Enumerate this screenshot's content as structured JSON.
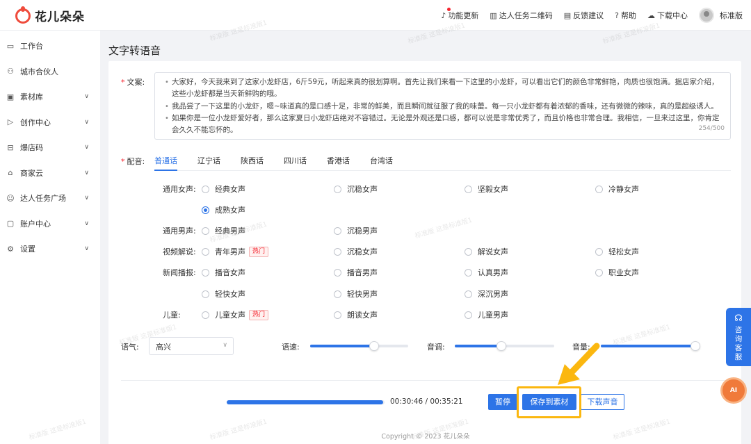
{
  "brand": {
    "name": "花儿朵朵"
  },
  "header": {
    "links": [
      {
        "label": "功能更新",
        "icon": "bell-icon"
      },
      {
        "label": "达人任务二维码",
        "icon": "qrcode-icon"
      },
      {
        "label": "反馈建议",
        "icon": "feedback-icon"
      },
      {
        "label": "帮助",
        "icon": "help-icon"
      },
      {
        "label": "下载中心",
        "icon": "cloud-download-icon"
      }
    ],
    "version": "标准版"
  },
  "sidebar": {
    "items": [
      {
        "label": "工作台",
        "icon": "monitor-icon",
        "expandable": false
      },
      {
        "label": "城市合伙人",
        "icon": "partner-icon",
        "expandable": false
      },
      {
        "label": "素材库",
        "icon": "image-icon",
        "expandable": true
      },
      {
        "label": "创作中心",
        "icon": "video-icon",
        "expandable": true
      },
      {
        "label": "爆店码",
        "icon": "code-icon",
        "expandable": true
      },
      {
        "label": "商家云",
        "icon": "store-icon",
        "expandable": true
      },
      {
        "label": "达人任务广场",
        "icon": "user-icon",
        "expandable": true
      },
      {
        "label": "账户中心",
        "icon": "account-icon",
        "expandable": true
      },
      {
        "label": "设置",
        "icon": "gear-icon",
        "expandable": true
      }
    ]
  },
  "page": {
    "title": "文字转语音"
  },
  "form": {
    "text_label": "文案:",
    "text_paragraphs": [
      "大家好，今天我来到了这家小龙虾店，6斤59元，听起来真的很划算啊。首先让我们来看一下这里的小龙虾，可以看出它们的颜色非常鲜艳，肉质也很饱满。据店家介绍，这些小龙虾都是当天新鲜购的哦。",
      "我品尝了一下这里的小龙虾，嗯~味道真的是口感十足，非常的鲜美，而且瞬间就征服了我的味蕾。每一只小龙虾都有着浓郁的香味，还有微微的辣味，真的是超级诱人。",
      "如果你是一位小龙虾爱好者，那么这家夏日小龙虾店绝对不容错过。无论是外观还是口感，都可以说是非常优秀了，而且价格也非常合理。我相信，一旦来过这里，你肯定会久久不能忘怀的。"
    ],
    "char_count": "254/500",
    "voice_label": "配音:",
    "tabs": [
      "普通话",
      "辽宁话",
      "陕西话",
      "四川话",
      "香港话",
      "台湾话"
    ],
    "active_tab": 0,
    "voice_groups": [
      {
        "label": "通用女声:",
        "options": [
          {
            "label": "经典女声"
          },
          {
            "label": "沉稳女声"
          },
          {
            "label": "坚毅女声"
          },
          {
            "label": "冷静女声"
          },
          {
            "label": "成熟女声",
            "selected": true
          }
        ]
      },
      {
        "label": "通用男声:",
        "options": [
          {
            "label": "经典男声"
          },
          {
            "label": "沉稳男声"
          }
        ]
      },
      {
        "label": "视频解说:",
        "options": [
          {
            "label": "青年男声",
            "tag": "热门"
          },
          {
            "label": "沉稳女声"
          },
          {
            "label": "解说女声"
          },
          {
            "label": "轻松女声"
          }
        ]
      },
      {
        "label": "新闻播报:",
        "options": [
          {
            "label": "播音女声"
          },
          {
            "label": "播音男声"
          },
          {
            "label": "认真男声"
          },
          {
            "label": "职业女声"
          },
          {
            "label": "轻快女声"
          },
          {
            "label": "轻快男声"
          },
          {
            "label": "深沉男声"
          }
        ]
      },
      {
        "label": "儿童:",
        "options": [
          {
            "label": "儿童女声",
            "tag": "热门"
          },
          {
            "label": "朗读女声"
          },
          {
            "label": "儿童男声"
          }
        ]
      }
    ],
    "mood_label": "语气:",
    "mood_value": "高兴",
    "speed_label": "语速:",
    "speed_value": 0.65,
    "pitch_label": "音调:",
    "pitch_value": 0.47,
    "volume_label": "音量:",
    "volume_value": 0.95
  },
  "player": {
    "progress": 0.99,
    "current_time": "00:30:46",
    "total_time": "00:35:21",
    "pause_label": "暂停",
    "save_label": "保存到素材",
    "download_label": "下载声音"
  },
  "footer": {
    "copyright": "Copyright © 2023 花儿朵朵"
  },
  "support": {
    "label": "咨询客服"
  },
  "ai_badge": {
    "label": "AI"
  },
  "watermark": {
    "text": "标准版 这是标准版1"
  },
  "colors": {
    "accent": "#2d74e7",
    "brand": "#ef4b3c",
    "highlight": "#fbb70f"
  }
}
